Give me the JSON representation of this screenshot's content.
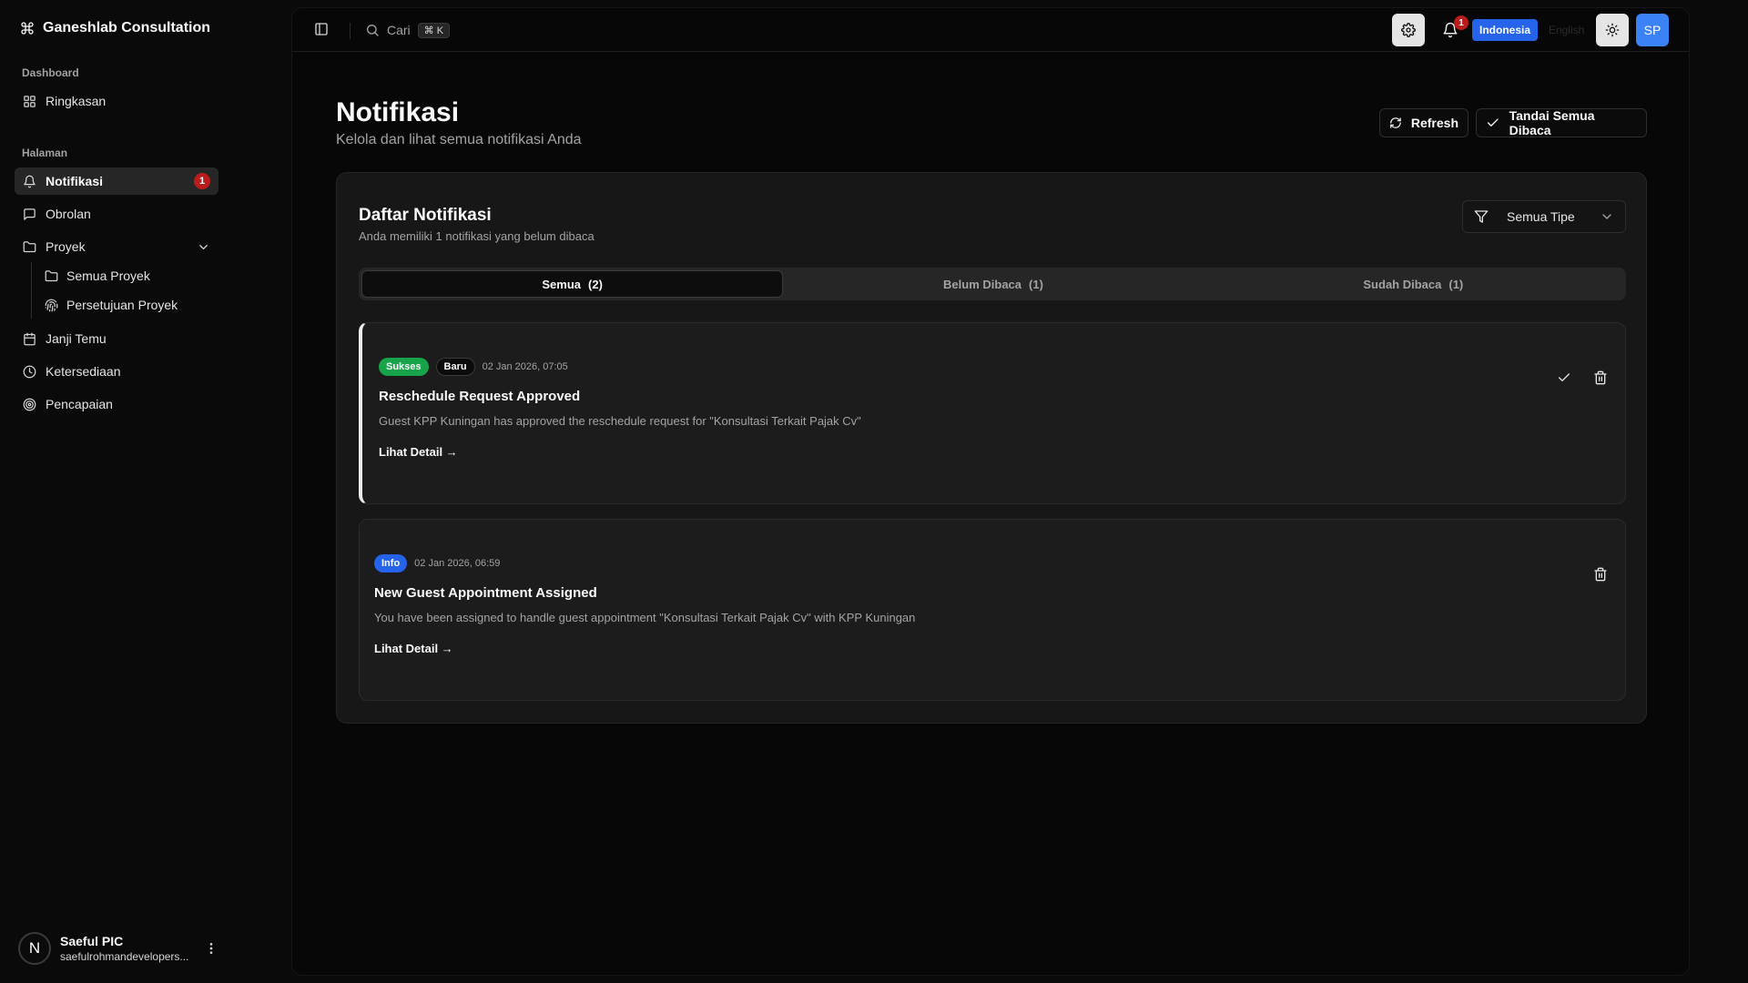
{
  "app": {
    "brand": "Ganeshlab Consultation"
  },
  "sidebar": {
    "groups": [
      {
        "label": "Dashboard"
      },
      {
        "label": "Halaman"
      }
    ],
    "items": [
      {
        "label": "Ringkasan",
        "icon": "layout-grid-icon"
      },
      {
        "label": "Notifikasi",
        "icon": "bell-icon",
        "badge": "1",
        "active": true
      },
      {
        "label": "Obrolan",
        "icon": "message-square-icon"
      },
      {
        "label": "Proyek",
        "icon": "folder-icon"
      },
      {
        "label": "Janji Temu",
        "icon": "calendar-icon"
      },
      {
        "label": "Ketersediaan",
        "icon": "clock-icon"
      },
      {
        "label": "Pencapaian",
        "icon": "target-icon"
      }
    ],
    "sub_items": [
      {
        "label": "Semua Proyek",
        "icon": "folder-icon"
      },
      {
        "label": "Persetujuan Proyek",
        "icon": "fingerprint-icon"
      }
    ],
    "user": {
      "initial": "N",
      "name": "Saeful PIC",
      "email": "saefulrohmandevelopers..."
    }
  },
  "topbar": {
    "search_label": "Cari",
    "search_shortcut": "⌘ K",
    "notif_count": "1",
    "lang_active": "Indonesia",
    "lang_other": "English",
    "avatar_initials": "SP"
  },
  "page": {
    "title": "Notifikasi",
    "subtitle": "Kelola dan lihat semua notifikasi Anda",
    "refresh_label": "Refresh",
    "mark_all_label": "Tandai Semua Dibaca"
  },
  "card": {
    "title": "Daftar Notifikasi",
    "subtitle": "Anda memiliki 1 notifikasi yang belum dibaca",
    "filter_label": "Semua Tipe",
    "tabs": [
      {
        "label": "Semua",
        "count": "(2)"
      },
      {
        "label": "Belum Dibaca",
        "count": "(1)"
      },
      {
        "label": "Sudah Dibaca",
        "count": "(1)"
      }
    ]
  },
  "notifications": [
    {
      "type_label": "Sukses",
      "new_label": "Baru",
      "date": "02 Jan 2026, 07:05",
      "title": "Reschedule Request Approved",
      "description": "Guest KPP Kuningan has approved the reschedule request for \"Konsultasi Terkait Pajak Cv\"",
      "link": "Lihat Detail →"
    },
    {
      "type_label": "Info",
      "date": "02 Jan 2026, 06:59",
      "title": "New Guest Appointment Assigned",
      "description": "You have been assigned to handle guest appointment \"Konsultasi Terkait Pajak Cv\" with KPP Kuningan",
      "link": "Lihat Detail →"
    }
  ],
  "colors": {
    "success": "#16a34a",
    "info": "#2563eb",
    "badge_red": "#b91c1c",
    "avatar_blue": "#3b82f6"
  }
}
